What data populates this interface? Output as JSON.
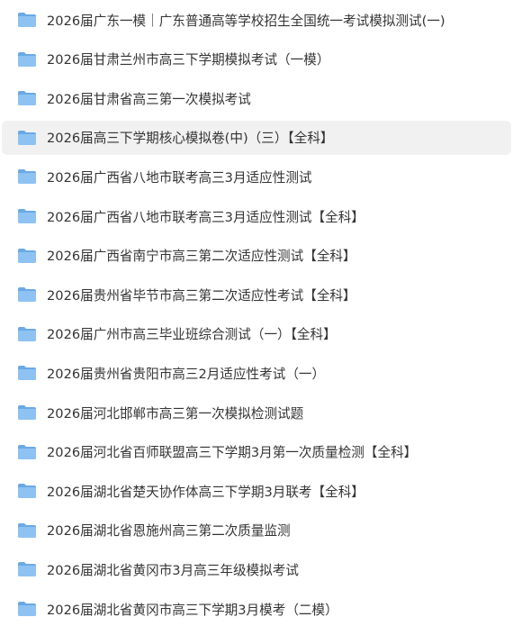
{
  "colors": {
    "folder_front": "#8ec2f2",
    "folder_back": "#6aa9e6",
    "text": "#333333",
    "hover_background": "#f1f1f1"
  },
  "folders": [
    {
      "label": "2026届广东一模｜广东普通高等学校招生全国统一考试模拟测试(一)",
      "icon": "folder-icon"
    },
    {
      "label": "2026届甘肃兰州市高三下学期模拟考试（一模）",
      "icon": "folder-icon"
    },
    {
      "label": "2026届甘肃省高三第一次模拟考试",
      "icon": "folder-icon"
    },
    {
      "label": "2026届高三下学期核心模拟卷(中)（三）【全科】",
      "icon": "folder-icon",
      "hovered": true
    },
    {
      "label": "2026届广西省八地市联考高三3月适应性测试",
      "icon": "folder-icon"
    },
    {
      "label": "2026届广西省八地市联考高三3月适应性测试【全科】",
      "icon": "folder-icon"
    },
    {
      "label": "2026届广西省南宁市高三第二次适应性测试【全科】",
      "icon": "folder-icon"
    },
    {
      "label": "2026届贵州省毕节市高三第二次适应性考试【全科】",
      "icon": "folder-icon"
    },
    {
      "label": "2026届广州市高三毕业班综合测试（一）【全科】",
      "icon": "folder-icon"
    },
    {
      "label": "2026届贵州省贵阳市高三2月适应性考试（一）",
      "icon": "folder-icon"
    },
    {
      "label": "2026届河北邯郸市高三第一次模拟检测试题",
      "icon": "folder-icon"
    },
    {
      "label": "2026届河北省百师联盟高三下学期3月第一次质量检测【全科】",
      "icon": "folder-icon"
    },
    {
      "label": "2026届湖北省楚天协作体高三下学期3月联考【全科】",
      "icon": "folder-icon"
    },
    {
      "label": "2026届湖北省恩施州高三第二次质量监测",
      "icon": "folder-icon"
    },
    {
      "label": "2026届湖北省黄冈市3月高三年级模拟考试",
      "icon": "folder-icon"
    },
    {
      "label": "2026届湖北省黄冈市高三下学期3月模考（二模）",
      "icon": "folder-icon"
    }
  ]
}
